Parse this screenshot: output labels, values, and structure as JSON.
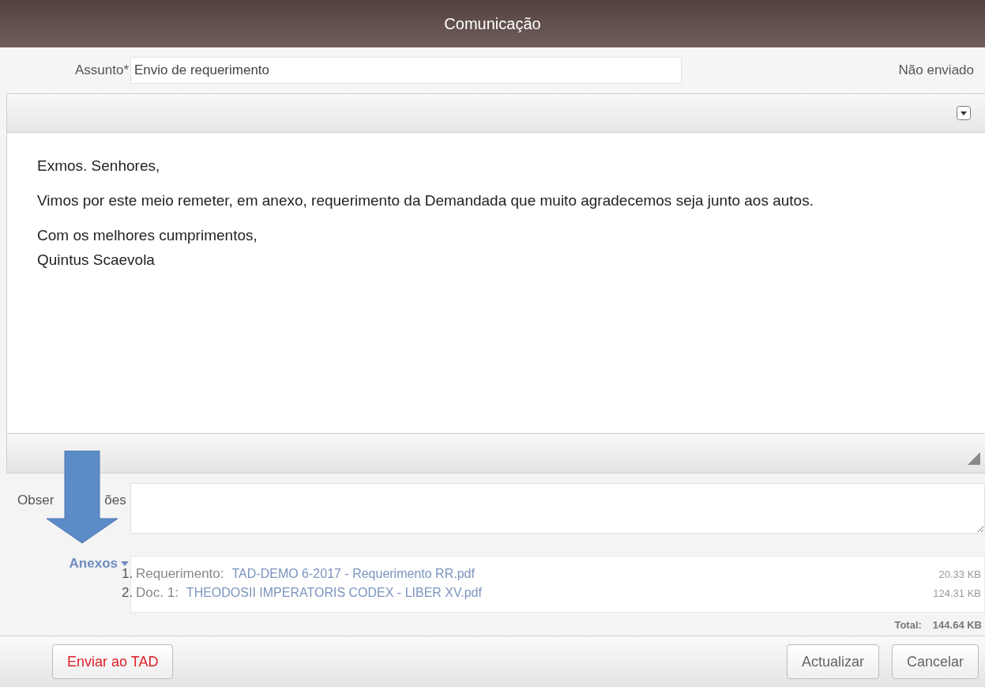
{
  "window": {
    "title": "Comunicação"
  },
  "subject": {
    "label": "Assunto",
    "required_mark": "*",
    "value": "Envio de requerimento",
    "status": "Não enviado"
  },
  "editor": {
    "paragraphs": [
      [
        "Exmos. Senhores,"
      ],
      [
        "Vimos por este meio remeter, em anexo, requerimento da Demandada que muito agradecemos seja junto aos autos."
      ],
      [
        "Com os melhores cumprimentos,",
        "Quintus Scaevola"
      ]
    ]
  },
  "notes": {
    "label_parts": [
      "Obser",
      "ões"
    ]
  },
  "attachments": {
    "label": "Anexos",
    "items": [
      {
        "number": "1.",
        "type": "Requerimento:",
        "file": "TAD-DEMO 6-2017 - Requerimento RR.pdf",
        "size": "20.33 KB"
      },
      {
        "number": "2.",
        "type": "Doc. 1:",
        "file": "THEODOSII IMPERATORIS CODEX - LIBER XV.pdf",
        "size": "124.31 KB"
      }
    ],
    "total_label": "Total:",
    "total": "144.64 KB"
  },
  "buttons": [
    {
      "label": "Enviar ao TAD",
      "kind": "danger"
    },
    {
      "label": "Actualizar",
      "kind": "normal"
    },
    {
      "label": "Cancelar",
      "kind": "normal"
    }
  ]
}
